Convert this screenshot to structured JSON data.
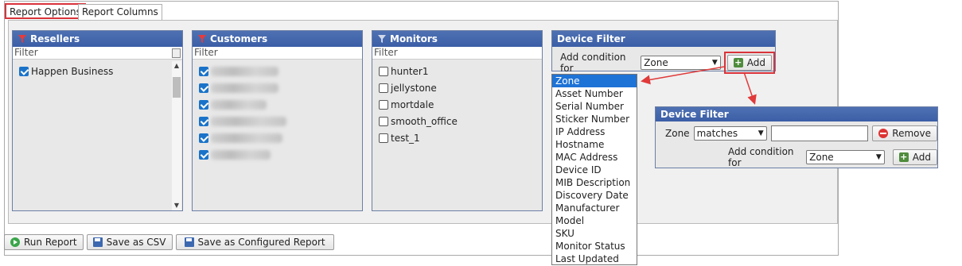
{
  "tabs": [
    {
      "label": "Report Options"
    },
    {
      "label": "Report Columns"
    }
  ],
  "panels": {
    "resellers": {
      "title": "Resellers",
      "filter_placeholder": "Filter",
      "items": [
        {
          "label": "Happen Business",
          "checked": true
        }
      ]
    },
    "customers": {
      "title": "Customers",
      "filter_placeholder": "Filter",
      "items": [
        {
          "checked": true
        },
        {
          "checked": true
        },
        {
          "checked": true
        },
        {
          "checked": true
        },
        {
          "checked": true
        },
        {
          "checked": true
        }
      ]
    },
    "monitors": {
      "title": "Monitors",
      "filter_placeholder": "Filter",
      "items": [
        {
          "label": "hunter1",
          "checked": false
        },
        {
          "label": "jellystone",
          "checked": false
        },
        {
          "label": "mortdale",
          "checked": false
        },
        {
          "label": "smooth_office",
          "checked": false
        },
        {
          "label": "test_1",
          "checked": false
        }
      ]
    }
  },
  "device_filter": {
    "title": "Device Filter",
    "add_condition_label": "Add condition for",
    "selected_condition": "Zone",
    "add_button": "Add"
  },
  "dropdown_options": [
    "Zone",
    "Asset Number",
    "Serial Number",
    "Sticker Number",
    "IP Address",
    "Hostname",
    "MAC Address",
    "Device ID",
    "MIB Description",
    "Discovery Date",
    "Manufacturer",
    "Model",
    "SKU",
    "Monitor Status",
    "Last Updated"
  ],
  "popup": {
    "title": "Device Filter",
    "condition_label": "Zone",
    "operator": "matches",
    "value": "",
    "remove_button": "Remove",
    "add_condition_label": "Add condition for",
    "selected_condition": "Zone",
    "add_button": "Add"
  },
  "bottom_buttons": {
    "run_report": "Run Report",
    "save_csv": "Save as CSV",
    "save_configured": "Save as Configured Report"
  },
  "colors": {
    "panel_header": "#3b5ea6",
    "highlight": "#d9333a",
    "dropdown_selected": "#1e73d6"
  }
}
